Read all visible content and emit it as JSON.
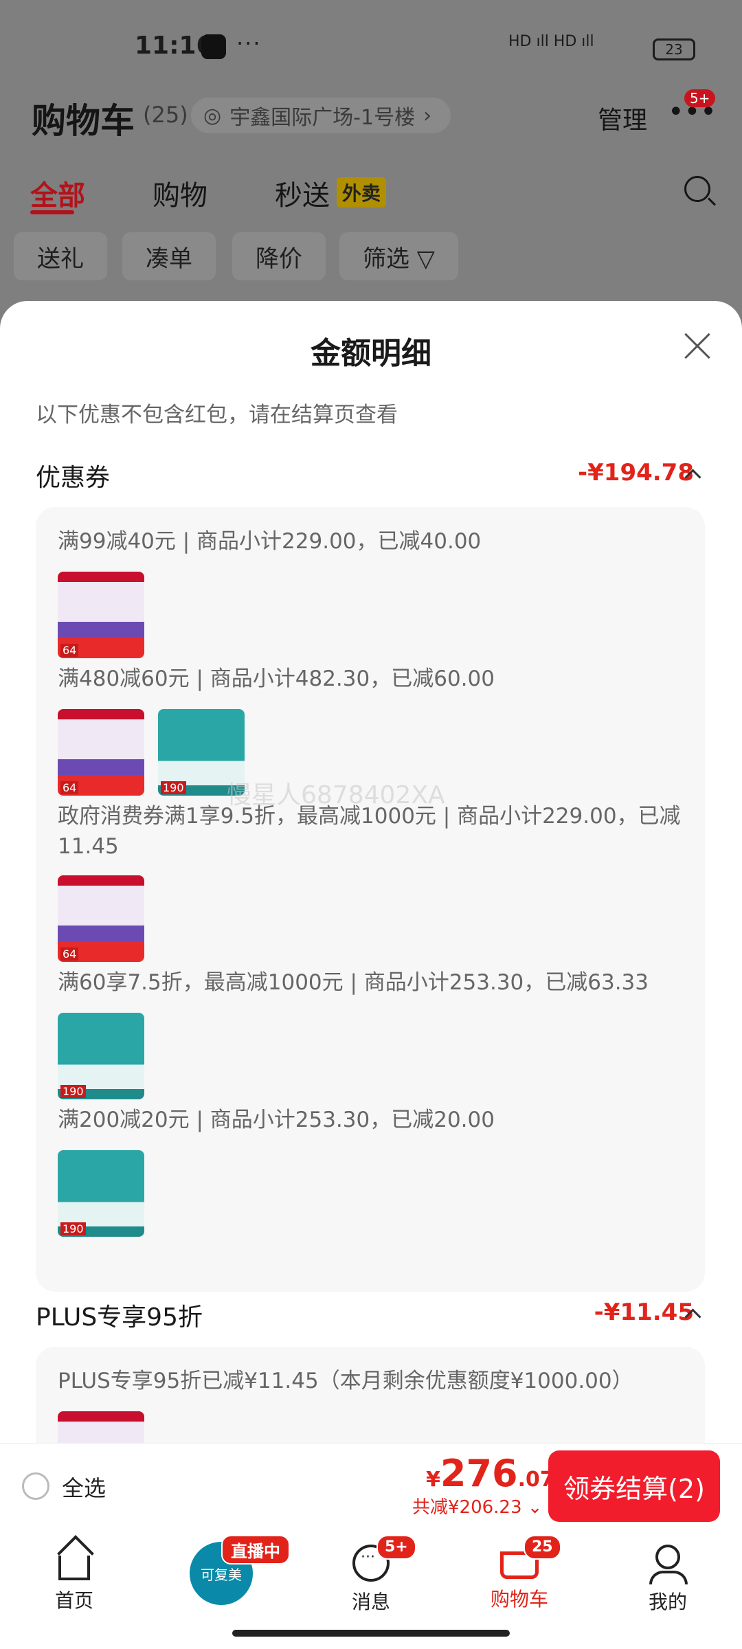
{
  "status_bar": {
    "time": "11:16",
    "dots": "···",
    "network": "HD ıll HD ıll",
    "battery": "23"
  },
  "header": {
    "title": "购物车",
    "count": "(25)",
    "address": "宇鑫国际广场-1号楼",
    "address_chevron": "›",
    "manage": "管理",
    "more_dots": "•••",
    "more_badge": "5+"
  },
  "tabs": [
    {
      "label": "全部"
    },
    {
      "label": "购物"
    },
    {
      "label": "秒送"
    }
  ],
  "waimai_badge": "外卖",
  "filter_chips": [
    "送礼",
    "凑单",
    "降价",
    "筛选 ▽"
  ],
  "sheet": {
    "title": "金额明细",
    "notice": "以下优惠不包含红包，请在结算页查看",
    "coupon_section": {
      "title": "优惠券",
      "amount": "-¥194.78",
      "lines": [
        "满99减40元 | 商品小计229.00，已减40.00",
        "满480减60元 | 商品小计482.30，已减60.00",
        "政府消费券满1享9.5折，最高减1000元 | 商品小计229.00，已减11.45",
        "满60享7.5折，最高减1000元 | 商品小计253.30，已减63.33",
        "满200减20元 | 商品小计253.30，已减20.00"
      ]
    },
    "plus_section": {
      "title": "PLUS专享95折",
      "amount": "-¥11.45",
      "line": "PLUS专享95折已减¥11.45（本月剩余优惠额度¥1000.00）"
    },
    "watermark": "慢星人6878402XA",
    "thumb_tags": {
      "a": "64",
      "b": "190"
    }
  },
  "checkout": {
    "select_all": "全选",
    "currency": "¥",
    "price_int": "276",
    "price_dec": ".07",
    "saved": "共减¥206.23 ⌄",
    "button": "领券结算(2)"
  },
  "tabbar": {
    "home": "首页",
    "live_brand": "可复美",
    "live_badge": "直播中",
    "messages": "消息",
    "messages_badge": "5+",
    "cart": "购物车",
    "cart_badge": "25",
    "me": "我的"
  }
}
